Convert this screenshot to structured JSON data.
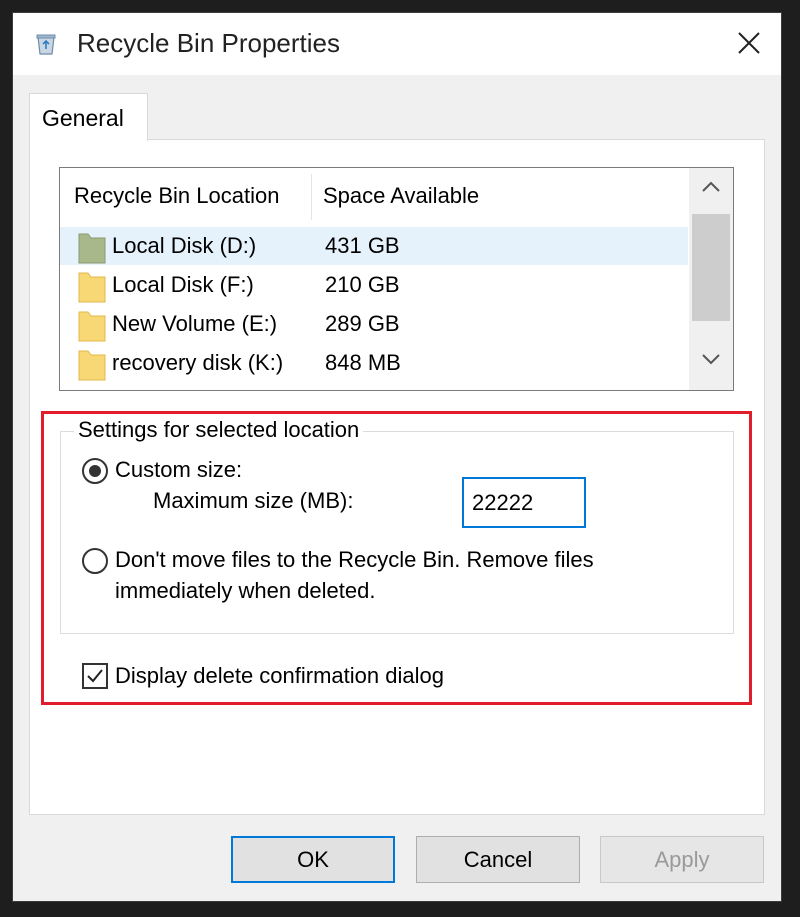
{
  "window": {
    "title": "Recycle Bin Properties"
  },
  "tabs": [
    {
      "label": "General",
      "active": true
    }
  ],
  "locations": {
    "columns": [
      "Recycle Bin Location",
      "Space Available"
    ],
    "rows": [
      {
        "name": "Local Disk (D:)",
        "space": "431 GB",
        "selected": true
      },
      {
        "name": "Local Disk (F:)",
        "space": "210 GB",
        "selected": false
      },
      {
        "name": "New Volume (E:)",
        "space": "289 GB",
        "selected": false
      },
      {
        "name": "recovery disk (K:)",
        "space": "848 MB",
        "selected": false
      }
    ]
  },
  "settings": {
    "group_label": "Settings for selected location",
    "custom_size_label": "Custom size:",
    "custom_size_selected": true,
    "max_size_label": "Maximum size (MB):",
    "max_size_value": "22222",
    "dont_move_label_line1": "Don't move files to the Recycle Bin. Remove files",
    "dont_move_label_line2": "immediately when deleted.",
    "dont_move_selected": false,
    "confirm_label": "Display delete confirmation dialog",
    "confirm_checked": true
  },
  "buttons": {
    "ok": "OK",
    "cancel": "Cancel",
    "apply": "Apply"
  },
  "colors": {
    "highlight": "#e11d2b",
    "focus_accent": "#0078d7",
    "folder": "#f8d775",
    "folder_selected": "#a8b88a"
  },
  "icons": {
    "app": "recycle-bin-icon",
    "close": "close-icon",
    "folder": "folder-icon",
    "scroll_up": "chevron-up-icon",
    "scroll_down": "chevron-down-icon",
    "check": "checkmark-icon"
  }
}
